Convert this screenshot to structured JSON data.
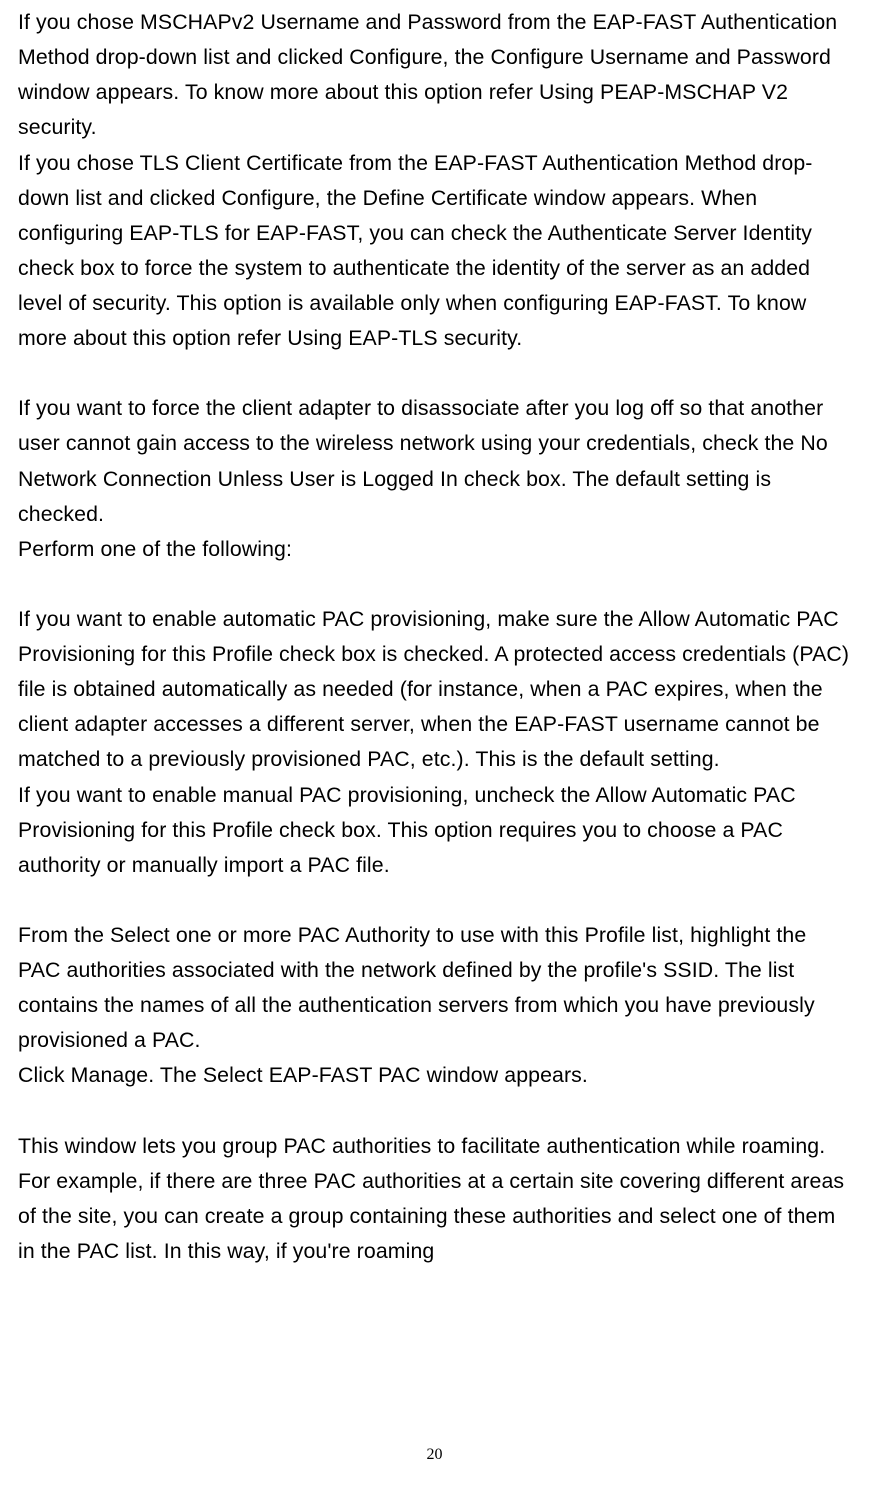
{
  "paragraphs": {
    "p1": "If you chose MSCHAPv2 Username and Password from the EAP-FAST Authentication Method drop-down list and clicked Configure, the Configure Username and Password window appears. To know more about this option refer Using PEAP-MSCHAP V2 security.",
    "p2": "If you chose TLS Client Certificate from the EAP-FAST Authentication Method drop-down list and clicked Configure, the Define Certificate window appears. When configuring EAP-TLS for EAP-FAST, you can check the Authenticate Server Identity check box to force the system to authenticate the identity of the server as an added level of security. This option is available only when configuring EAP-FAST. To know more about this option refer Using EAP-TLS security.",
    "p3": "If you want to force the client adapter to disassociate after you log off so that another user cannot gain access to the wireless network using your credentials, check the No Network Connection Unless User is Logged In check box. The default setting is checked.",
    "p4": "Perform one of the following:",
    "p5": "If you want to enable automatic PAC provisioning, make sure the Allow Automatic PAC Provisioning for this Profile check box is checked. A protected access credentials (PAC) file is obtained automatically as needed (for instance, when a PAC expires, when the client adapter accesses a different server, when the EAP-FAST username cannot be matched to a previously provisioned PAC, etc.). This is the default setting.",
    "p6": "If you want to enable manual PAC provisioning, uncheck the Allow Automatic PAC Provisioning for this Profile check box. This option requires you to choose a PAC authority or manually import a PAC file.",
    "p7": "From the Select one or more PAC Authority to use with this Profile list, highlight the PAC authorities associated with the network defined by the profile's SSID. The list contains the names of all the authentication servers from which you have previously provisioned a PAC.",
    "p8": "Click Manage. The Select EAP-FAST PAC window appears.",
    "p9": "This window lets you group PAC authorities to facilitate authentication while roaming. For example, if there are three PAC authorities at a certain site covering different areas of the site, you can create a group containing these authorities and select one of them in the PAC list. In this way, if you're roaming"
  },
  "page_number": "20"
}
